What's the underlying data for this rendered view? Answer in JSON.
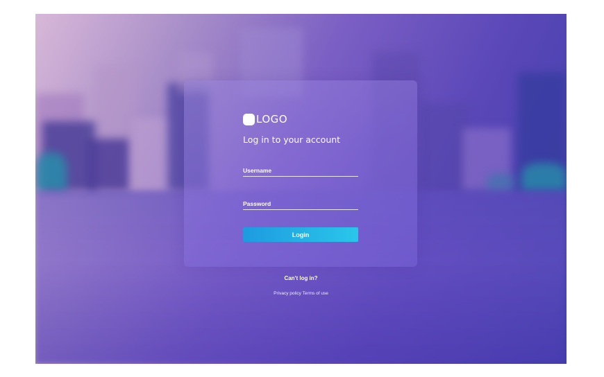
{
  "logo": {
    "text": "LOGO"
  },
  "login_form": {
    "subtitle": "Log in to your account",
    "username_label": "Username",
    "password_label": "Password",
    "login_button": "Login"
  },
  "links": {
    "cant_log_in": "Can't log in?",
    "privacy_policy": "Privacy policy",
    "terms_of_use": "Terms of use"
  },
  "colors": {
    "button_start": "#1e9be0",
    "button_end": "#2ac6ea",
    "background_start": "#d8b8d8",
    "background_end": "#3a3da8"
  }
}
